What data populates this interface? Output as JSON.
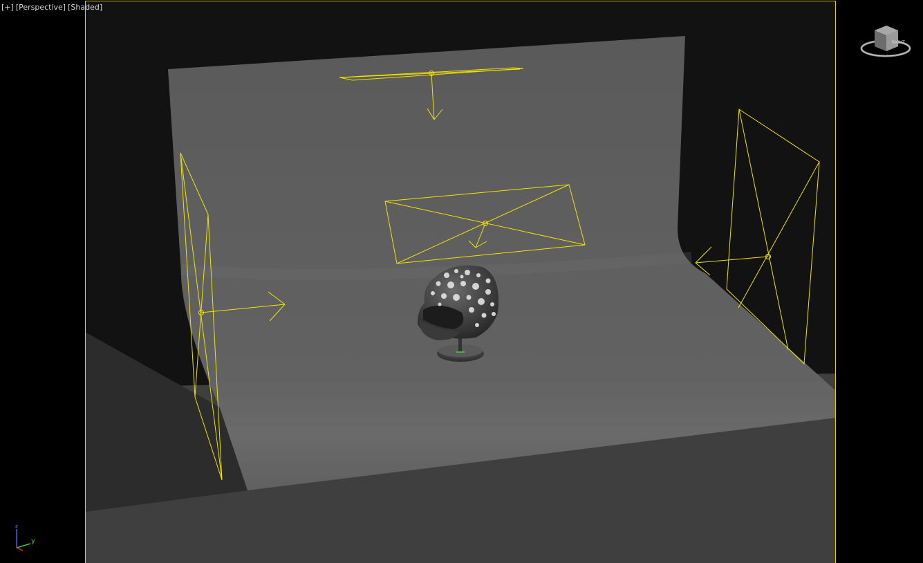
{
  "viewport": {
    "label_plus": "[+]",
    "label_view": "[Perspective]",
    "label_shading": "[Shaded]",
    "view_cube_face": "RIGHT",
    "axis_y_label": "y",
    "axis_z_label": "z"
  },
  "colors": {
    "background": "#000000",
    "viewport_fill": "#121212",
    "active_border": "#e8d000",
    "light_wire": "#f2e400",
    "backdrop": "#5f5f5f",
    "floor_dark": "#404040",
    "axis_x": "#d03030",
    "axis_y": "#40c040",
    "axis_z": "#4060ff"
  },
  "scene_objects": [
    "top-area-light",
    "front-area-light",
    "left-area-light",
    "right-area-light",
    "cyclorama-backdrop",
    "helmet-model"
  ]
}
